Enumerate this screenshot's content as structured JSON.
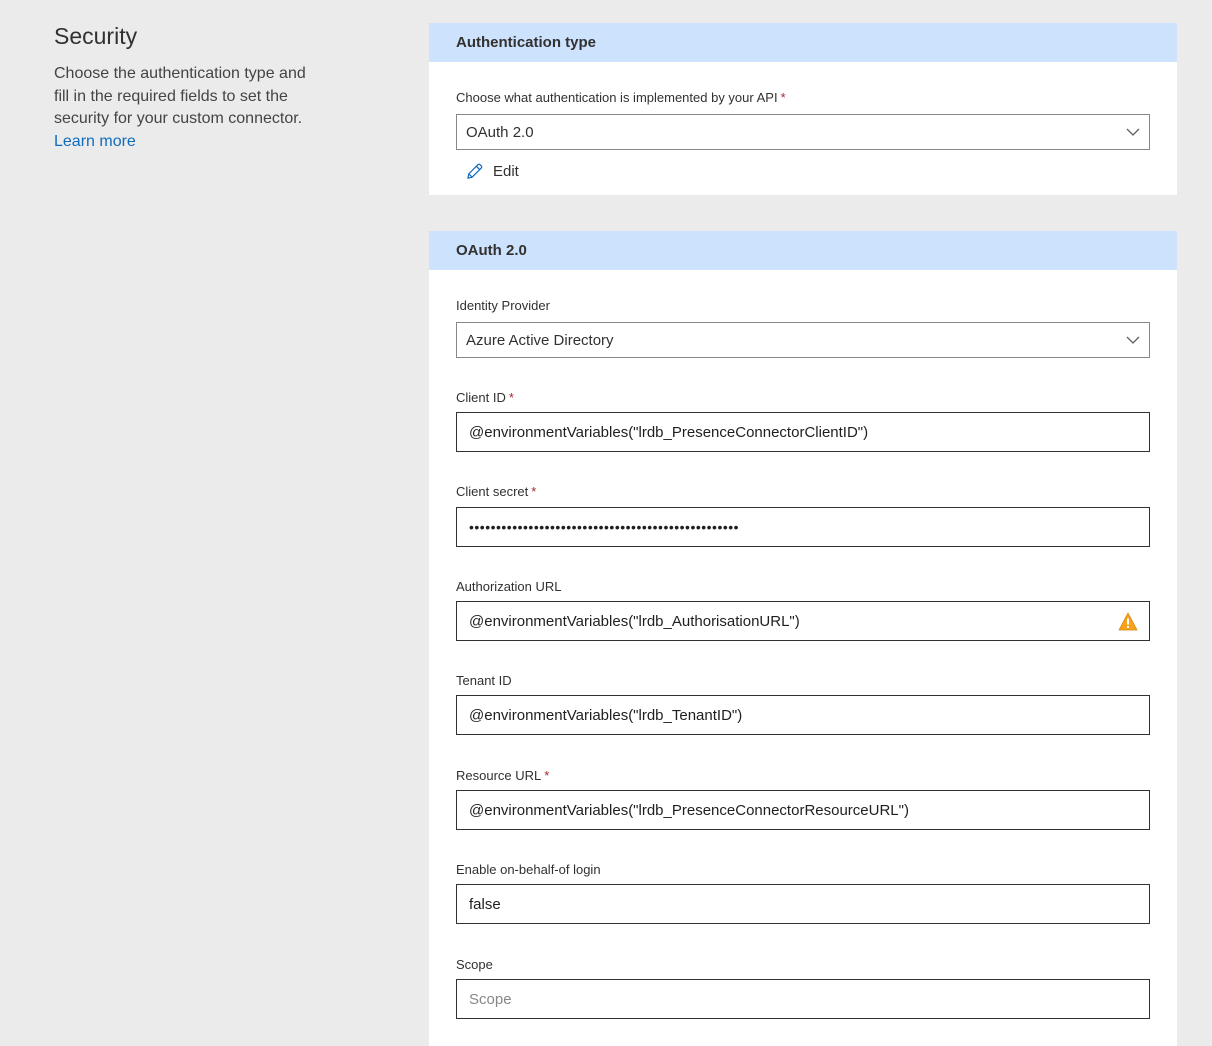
{
  "intro": {
    "title": "Security",
    "description": "Choose the authentication type and fill in the required fields to set the security for your custom connector.",
    "learn_more": "Learn more"
  },
  "auth_card": {
    "header": "Authentication type",
    "label": "Choose what authentication is implemented by your API",
    "required_mark": "*",
    "selected": "OAuth 2.0",
    "edit_label": "Edit"
  },
  "oauth_card": {
    "header": "OAuth 2.0",
    "identity_provider": {
      "label": "Identity Provider",
      "selected": "Azure Active Directory"
    },
    "client_id": {
      "label": "Client ID",
      "required_mark": "*",
      "value": "@environmentVariables(\"lrdb_PresenceConnectorClientID\")"
    },
    "client_secret": {
      "label": "Client secret",
      "required_mark": "*",
      "value": "••••••••••••••••••••••••••••••••••••••••••••••••••"
    },
    "authorization_url": {
      "label": "Authorization URL",
      "value": "@environmentVariables(\"lrdb_AuthorisationURL\")"
    },
    "tenant_id": {
      "label": "Tenant ID",
      "value": "@environmentVariables(\"lrdb_TenantID\")"
    },
    "resource_url": {
      "label": "Resource URL",
      "required_mark": "*",
      "value": "@environmentVariables(\"lrdb_PresenceConnectorResourceURL\")"
    },
    "on_behalf_of": {
      "label": "Enable on-behalf-of login",
      "value": "false"
    },
    "scope": {
      "label": "Scope",
      "placeholder": "Scope"
    }
  },
  "colors": {
    "page_bg": "#ebebeb",
    "header_bg": "#cde2fd",
    "link": "#0f6cbd",
    "required": "#a4262c",
    "warning": "#f7a21a",
    "edit_icon": "#0f6cbd"
  },
  "icons": {
    "chevron": "chevron-down-icon",
    "edit": "pencil-icon",
    "warning": "warning-triangle-icon"
  }
}
